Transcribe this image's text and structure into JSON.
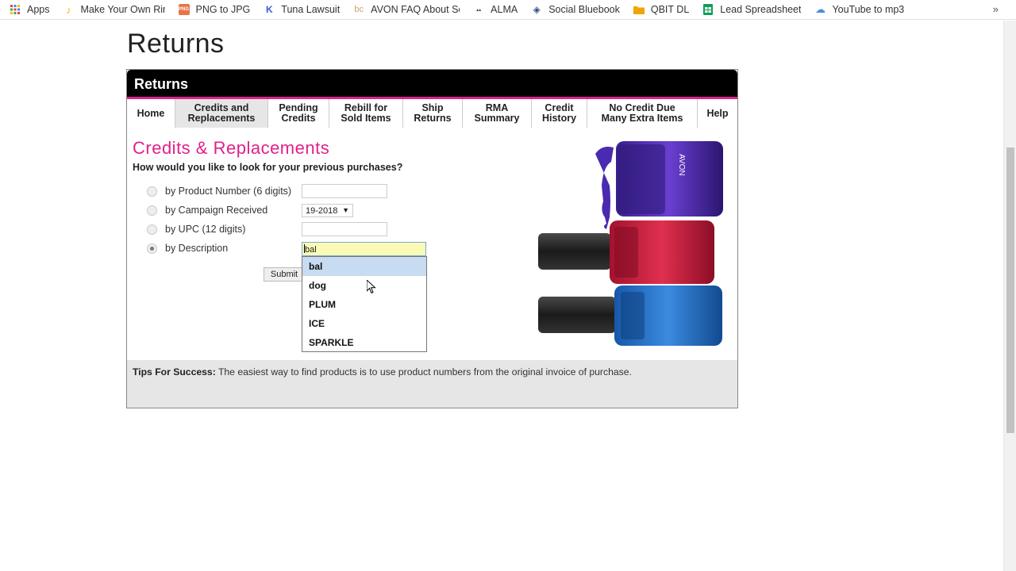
{
  "bookmarks": {
    "items": [
      {
        "label": "Apps",
        "icon": "apps-grid-icon",
        "color": "#4285f4"
      },
      {
        "label": "Make Your Own Ring",
        "icon": "music-note-icon",
        "color": "#f4b400"
      },
      {
        "label": "PNG to JPG",
        "icon": "png-jpg-icon",
        "color": "#e8734a"
      },
      {
        "label": "Tuna Lawsuit",
        "icon": "k-icon",
        "color": "#3b5bdb"
      },
      {
        "label": "AVON FAQ About Se",
        "icon": "bc-icon",
        "color": "#c9a26b"
      },
      {
        "label": "ALMA",
        "icon": "alma-icon",
        "color": "#444444"
      },
      {
        "label": "Social Bluebook",
        "icon": "book-icon",
        "color": "#2d4a8a"
      },
      {
        "label": "QBIT DL",
        "icon": "folder-icon",
        "color": "#f0a500"
      },
      {
        "label": "Lead Spreadsheet",
        "icon": "sheets-icon",
        "color": "#0f9d58"
      },
      {
        "label": "YouTube to mp3",
        "icon": "cloud-download-icon",
        "color": "#4a90d9"
      }
    ],
    "more": "»"
  },
  "page": {
    "title": "Returns"
  },
  "panel": {
    "header": "Returns",
    "nav": [
      {
        "line1": "Home",
        "line2": ""
      },
      {
        "line1": "Credits and",
        "line2": "Replacements"
      },
      {
        "line1": "Pending",
        "line2": "Credits"
      },
      {
        "line1": "Rebill for",
        "line2": "Sold Items"
      },
      {
        "line1": "Ship",
        "line2": "Returns"
      },
      {
        "line1": "RMA",
        "line2": "Summary"
      },
      {
        "line1": "Credit",
        "line2": "History"
      },
      {
        "line1": "No Credit Due",
        "line2": "Many Extra Items"
      },
      {
        "line1": "Help",
        "line2": ""
      }
    ],
    "active_nav": "Credits and Replacements",
    "section_title": "Credits & Replacements",
    "question": "How would you like to look for your previous purchases?",
    "options": {
      "product_number": "by Product Number (6 digits)",
      "campaign": "by Campaign Received",
      "upc": "by UPC (12 digits)",
      "description": "by Description"
    },
    "selected_option": "by Description",
    "campaign_value": "19-2018",
    "description_value": "bal",
    "submit_label": "Submit",
    "suggestions": [
      "bal",
      "dog",
      "PLUM",
      "ICE",
      "SPARKLE"
    ],
    "highlighted_suggestion": "bal",
    "bottle_brand": "AVON",
    "tips_label": "Tips For Success:",
    "tips_text": "The easiest way to find products is to use product numbers from the original invoice of purchase."
  },
  "colors": {
    "accent_pink": "#e0218a",
    "header_black": "#000000",
    "input_highlight": "#fafab5",
    "suggestion_highlight": "#c7dbf2"
  }
}
